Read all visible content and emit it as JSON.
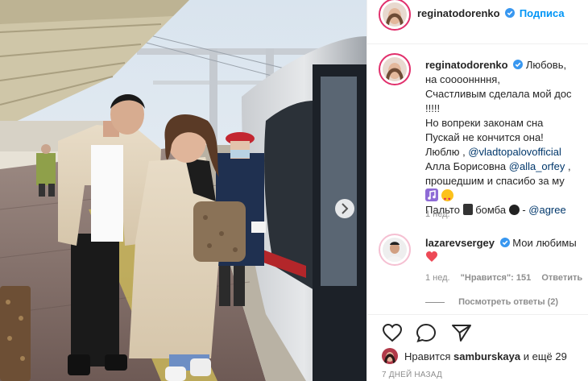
{
  "header": {
    "username": "reginatodorenko",
    "follow_label": "Подписа"
  },
  "caption": {
    "username": "reginatodorenko",
    "lines": [
      "Любовь,",
      "на сооооннння,",
      "Счастливым сделала мой дос",
      "!!!!!",
      "Но вопреки законам сна",
      "Пускай не кончится она!",
      "Люблю ,",
      "Алла Борисовна",
      "прошедшим и спасибо за му",
      "",
      "Пальто",
      "бомба"
    ],
    "mention_vlad": "@vladtopalovofficial",
    "mention_alla": "@alla_orfey",
    "mention_agree": "@agree",
    "time": "1 нед."
  },
  "comment": {
    "username": "lazarevsergey",
    "text": "Мои любимы",
    "time": "1 нед.",
    "likes": "\"Нравится\": 151",
    "reply": "Ответить",
    "view_replies": "Посмотреть ответы (2)"
  },
  "footer": {
    "likes_prefix": "Нравится",
    "likes_user": "samburskaya",
    "likes_suffix": "и ещё 29",
    "date": "7 ДНЕЙ НАЗАД"
  },
  "colors": {
    "accent": "#0095f6",
    "link": "#00376b",
    "story_ring": "#e1306c",
    "heart": "#ed4956"
  }
}
